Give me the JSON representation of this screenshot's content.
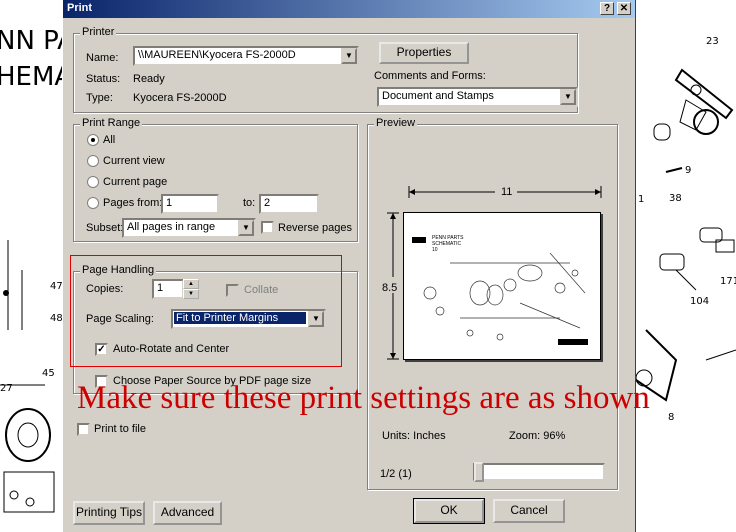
{
  "background": {
    "left_title_1": "NN PA",
    "left_title_2": "HEMA",
    "left_numbers": [
      "47",
      "48",
      "27",
      "45"
    ],
    "right_numbers": [
      "23",
      "9",
      "38",
      "1",
      "171",
      "104",
      "8"
    ]
  },
  "dialog": {
    "title": "Print",
    "help_button": "?",
    "close_button": "✕",
    "printer": {
      "group_label": "Printer",
      "name_label": "Name:",
      "name_value": "\\\\MAUREEN\\Kyocera FS-2000D",
      "status_label": "Status:",
      "status_value": "Ready",
      "type_label": "Type:",
      "type_value": "Kyocera FS-2000D",
      "properties_button": "Properties",
      "comments_label": "Comments and Forms:",
      "comments_value": "Document and Stamps"
    },
    "print_range": {
      "group_label": "Print Range",
      "all": "All",
      "current_view": "Current view",
      "current_page": "Current page",
      "pages_from": "Pages from:",
      "from_value": "1",
      "to_label": "to:",
      "to_value": "2",
      "subset_label": "Subset:",
      "subset_value": "All pages in range",
      "reverse_pages": "Reverse pages"
    },
    "page_handling": {
      "group_label": "Page Handling",
      "copies_label": "Copies:",
      "copies_value": "1",
      "collate": "Collate",
      "scaling_label": "Page Scaling:",
      "scaling_value": "Fit to Printer Margins",
      "auto_rotate": "Auto-Rotate and Center",
      "choose_paper": "Choose Paper Source by PDF page size"
    },
    "print_to_file": "Print to file",
    "preview": {
      "group_label": "Preview",
      "width": "11",
      "height": "8.5",
      "thumb_title": "PENN PARTS\nSCHEMATIC\n10",
      "units": "Units: Inches",
      "zoom": "Zoom:  96%",
      "page_indicator": "1/2 (1)",
      "page_fraction": 0.0
    },
    "buttons": {
      "printing_tips": "Printing Tips",
      "advanced": "Advanced",
      "ok": "OK",
      "cancel": "Cancel"
    }
  },
  "annotation": "Make sure these print settings are as shown",
  "colors": {
    "dialog_face": "#d4d0c8",
    "title_start": "#0a246a",
    "title_end": "#a6caf0",
    "annotation_red": "#cc0000",
    "selection_blue": "#0a246a"
  }
}
